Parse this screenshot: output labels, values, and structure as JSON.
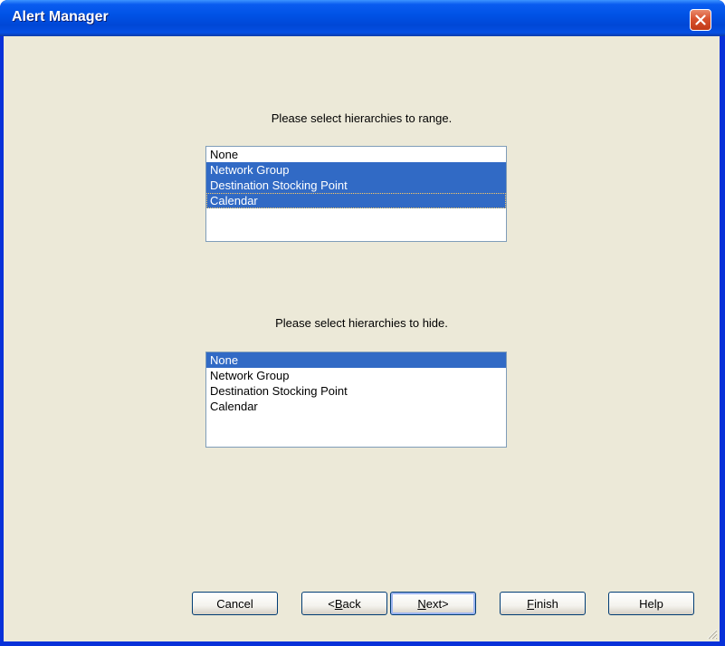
{
  "window": {
    "title": "Alert Manager"
  },
  "range_section": {
    "prompt": "Please select hierarchies to range.",
    "items": [
      {
        "label": "None",
        "selected": false
      },
      {
        "label": "Network Group",
        "selected": true
      },
      {
        "label": "Destination Stocking Point",
        "selected": true
      },
      {
        "label": "Calendar",
        "selected": true
      }
    ]
  },
  "hide_section": {
    "prompt": "Please select hierarchies to hide.",
    "items": [
      {
        "label": "None",
        "selected": true
      },
      {
        "label": "Network Group",
        "selected": false
      },
      {
        "label": "Destination Stocking Point",
        "selected": false
      },
      {
        "label": "Calendar",
        "selected": false
      }
    ]
  },
  "buttons": {
    "cancel": {
      "label": "Cancel"
    },
    "back": {
      "label": "<Back",
      "accel_index": 1
    },
    "next": {
      "label": "Next>",
      "accel_index": 0
    },
    "finish": {
      "label": "Finish",
      "accel_index": 0
    },
    "help": {
      "label": "Help"
    }
  },
  "colors": {
    "title_bar": "#0053e6",
    "client_background": "#ece9d8",
    "selection": "#316ac5",
    "close_button": "#d8522f"
  },
  "icons": [
    "close-icon",
    "resize-grip-icon"
  ]
}
